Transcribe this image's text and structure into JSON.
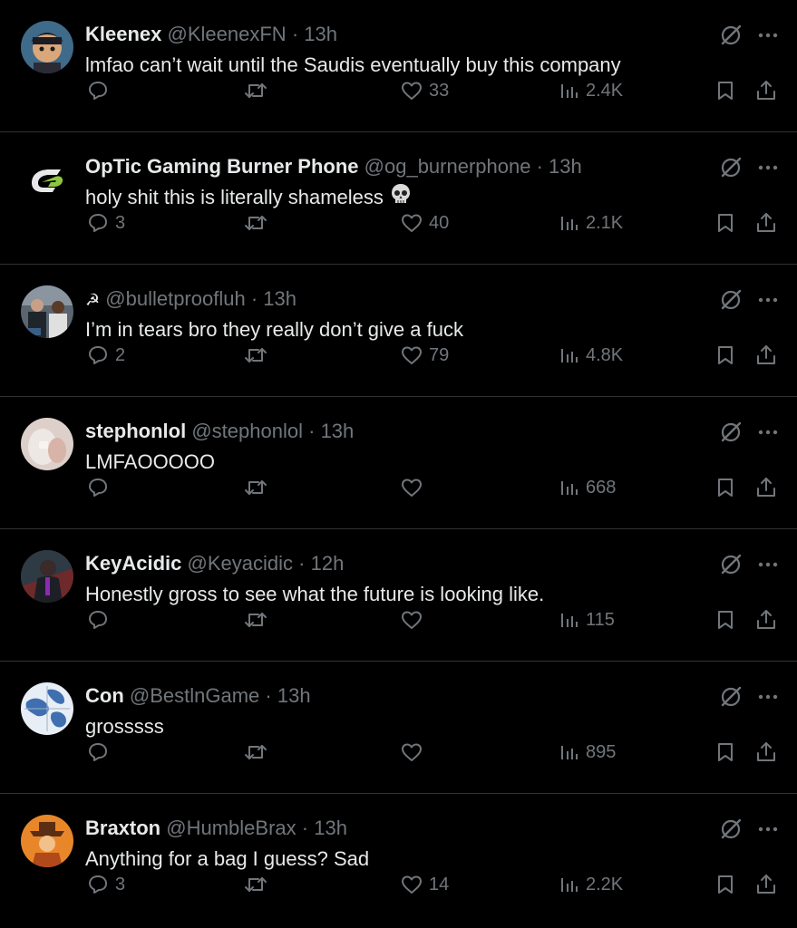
{
  "colors": {
    "background": "#000000",
    "primary_text": "#e7e9ea",
    "secondary_text": "#71767b",
    "divider": "#2f3336"
  },
  "icons": {
    "reply": "reply-icon",
    "retweet": "retweet-icon",
    "like": "like-icon",
    "views": "views-icon",
    "bookmark": "bookmark-icon",
    "share": "share-icon",
    "grok": "grok-icon",
    "more": "more-icon"
  },
  "tweets": [
    {
      "name": "Kleenex",
      "handle": "@KleenexFN",
      "separator": "·",
      "time": "13h",
      "text": "lmfao can’t wait until the Saudis eventually buy this company",
      "replies": "",
      "retweets": "",
      "likes": "33",
      "views": "2.4K"
    },
    {
      "name": "OpTic Gaming Burner Phone",
      "handle": "@og_burnerphone",
      "separator": "·",
      "time": "13h",
      "text": "holy shit this is literally shameless",
      "emoji": "skull-emoji",
      "replies": "3",
      "retweets": "",
      "likes": "40",
      "views": "2.1K"
    },
    {
      "name": "",
      "name_symbol": "☭",
      "handle": "@bulletproofluh",
      "separator": "·",
      "time": "13h",
      "text": "I’m in tears bro they really don’t give a fuck",
      "replies": "2",
      "retweets": "",
      "likes": "79",
      "views": "4.8K"
    },
    {
      "name": "stephonlol",
      "handle": "@stephonlol",
      "separator": "·",
      "time": "13h",
      "text": "LMFAOOOOO",
      "replies": "",
      "retweets": "",
      "likes": "",
      "views": "668"
    },
    {
      "name": "KeyAcidic",
      "handle": "@Keyacidic",
      "separator": "·",
      "time": "12h",
      "text": "Honestly gross to see what the future is looking like.",
      "replies": "",
      "retweets": "",
      "likes": "",
      "views": "115"
    },
    {
      "name": "Con",
      "handle": "@BestlnGame",
      "separator": "·",
      "time": "13h",
      "text": "grosssss",
      "replies": "",
      "retweets": "",
      "likes": "",
      "views": "895"
    },
    {
      "name": "Braxton",
      "handle": "@HumbleBrax",
      "separator": "·",
      "time": "13h",
      "text": "Anything for a bag I guess? Sad",
      "replies": "3",
      "retweets": "",
      "likes": "14",
      "views": "2.2K"
    }
  ]
}
